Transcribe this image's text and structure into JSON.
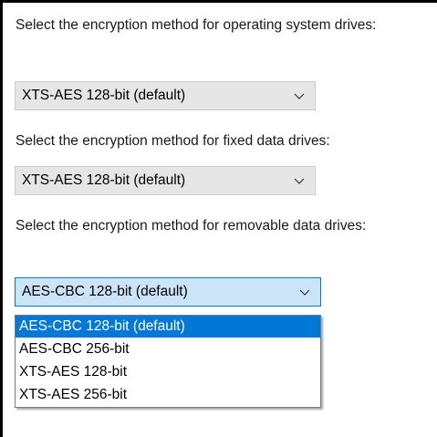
{
  "os_drives": {
    "label": "Select the encryption method for operating system drives:",
    "value": "XTS-AES 128-bit (default)"
  },
  "fixed_drives": {
    "label": "Select the encryption method for fixed data drives:",
    "value": "XTS-AES 128-bit (default)"
  },
  "removable_drives": {
    "label": "Select the encryption method for removable data drives:",
    "value": "AES-CBC 128-bit  (default)",
    "options": [
      "AES-CBC 128-bit  (default)",
      "AES-CBC 256-bit",
      "XTS-AES 128-bit",
      "XTS-AES 256-bit"
    ]
  },
  "icons": {
    "dropdown_arrow": "chevron-down-icon"
  },
  "colors": {
    "combo_background": "#e6e6e6",
    "combo_open_background": "#cce4f7",
    "accent": "#0078d7"
  }
}
